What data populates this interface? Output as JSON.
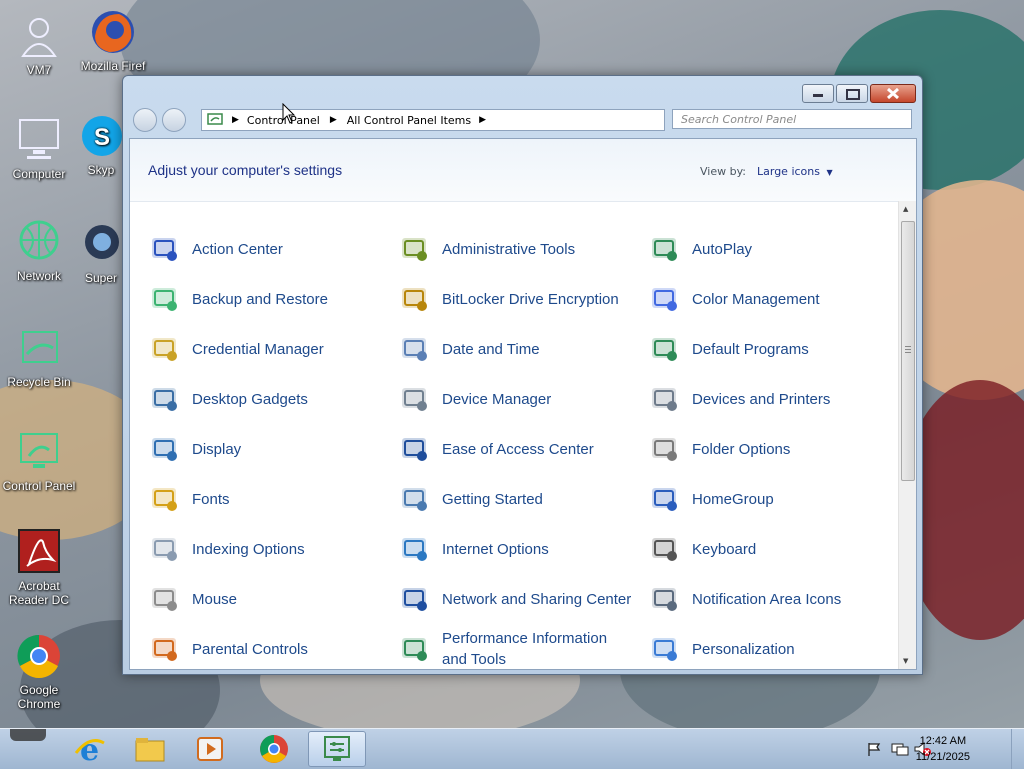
{
  "desktop": {
    "icons": [
      {
        "label": "VM7",
        "icon": "user-icon"
      },
      {
        "label": "Mozilla Firef",
        "icon": "firefox-icon"
      },
      {
        "label": "Computer",
        "icon": "computer-icon"
      },
      {
        "label": "Skyp",
        "icon": "skype-icon"
      },
      {
        "label": "Network",
        "icon": "network-icon"
      },
      {
        "label": "Super",
        "icon": "globe-icon"
      },
      {
        "label": "Recycle Bin",
        "icon": "recycle-bin-icon"
      },
      {
        "label": "Control Panel",
        "icon": "control-panel-icon"
      },
      {
        "label": "Acrobat Reader DC",
        "icon": "acrobat-icon"
      },
      {
        "label": "Google Chrome",
        "icon": "chrome-icon"
      }
    ]
  },
  "window": {
    "breadcrumb": [
      "Control Panel",
      "All Control Panel Items"
    ],
    "search_placeholder": "Search Control Panel",
    "heading": "Adjust your computer's settings",
    "view_by_label": "View by:",
    "view_by_value": "Large icons",
    "items": [
      {
        "label": "Action Center",
        "icon": "flag-icon",
        "color": "#2a52be"
      },
      {
        "label": "Administrative Tools",
        "icon": "admin-tools-icon",
        "color": "#6b8e23"
      },
      {
        "label": "AutoPlay",
        "icon": "autoplay-icon",
        "color": "#2e8b57"
      },
      {
        "label": "Backup and Restore",
        "icon": "backup-icon",
        "color": "#3cb371"
      },
      {
        "label": "BitLocker Drive Encryption",
        "icon": "key-icon",
        "color": "#b8860b"
      },
      {
        "label": "Color Management",
        "icon": "color-icon",
        "color": "#4169e1"
      },
      {
        "label": "Credential Manager",
        "icon": "vault-icon",
        "color": "#c9a227"
      },
      {
        "label": "Date and Time",
        "icon": "calendar-icon",
        "color": "#5a7fb5"
      },
      {
        "label": "Default Programs",
        "icon": "default-programs-icon",
        "color": "#2e8b57"
      },
      {
        "label": "Desktop Gadgets",
        "icon": "gadgets-icon",
        "color": "#3a6ea5"
      },
      {
        "label": "Device Manager",
        "icon": "device-manager-icon",
        "color": "#708090"
      },
      {
        "label": "Devices and Printers",
        "icon": "printer-icon",
        "color": "#6e7b8b"
      },
      {
        "label": "Display",
        "icon": "display-icon",
        "color": "#2f6fb2"
      },
      {
        "label": "Ease of Access Center",
        "icon": "accessibility-icon",
        "color": "#1f4e9c"
      },
      {
        "label": "Folder Options",
        "icon": "folder-options-icon",
        "color": "#7a7a7a"
      },
      {
        "label": "Fonts",
        "icon": "fonts-icon",
        "color": "#d4a017"
      },
      {
        "label": "Getting Started",
        "icon": "getting-started-icon",
        "color": "#4a7ab0"
      },
      {
        "label": "HomeGroup",
        "icon": "homegroup-icon",
        "color": "#2a5dbd"
      },
      {
        "label": "Indexing Options",
        "icon": "indexing-icon",
        "color": "#8a9bb0"
      },
      {
        "label": "Internet Options",
        "icon": "internet-icon",
        "color": "#2b78c2"
      },
      {
        "label": "Keyboard",
        "icon": "keyboard-icon",
        "color": "#555555"
      },
      {
        "label": "Mouse",
        "icon": "mouse-icon",
        "color": "#8c8c8c"
      },
      {
        "label": "Network and Sharing Center",
        "icon": "network-sharing-icon",
        "color": "#1f4fa0"
      },
      {
        "label": "Notification Area Icons",
        "icon": "notification-icon",
        "color": "#5a6a7e"
      },
      {
        "label": "Parental Controls",
        "icon": "parental-controls-icon",
        "color": "#d2691e"
      },
      {
        "label": "Performance Information and Tools",
        "icon": "performance-icon",
        "color": "#2e8b57"
      },
      {
        "label": "Personalization",
        "icon": "personalization-icon",
        "color": "#3a7bd5"
      }
    ]
  },
  "taskbar": {
    "apps": [
      {
        "name": "Internet Explorer",
        "icon": "ie-icon"
      },
      {
        "name": "Windows Explorer",
        "icon": "explorer-icon"
      },
      {
        "name": "Media Player",
        "icon": "media-player-icon"
      },
      {
        "name": "Google Chrome",
        "icon": "chrome-icon"
      },
      {
        "name": "Control Panel",
        "icon": "control-panel-icon"
      }
    ],
    "time": "12:42 AM",
    "date": "11/21/2025"
  }
}
